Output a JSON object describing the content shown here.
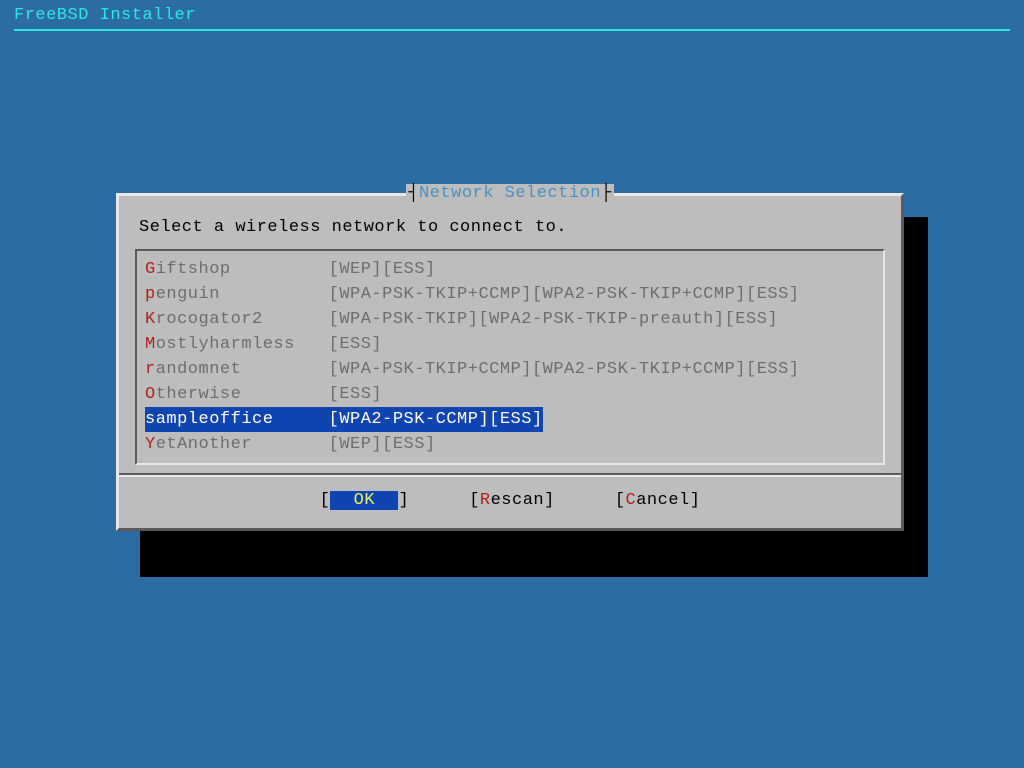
{
  "header": {
    "title": "FreeBSD Installer"
  },
  "dialog": {
    "title": "Network Selection",
    "prompt": "Select a wireless network to connect to.",
    "selected_index": 6,
    "networks": [
      {
        "hot": "G",
        "rest": "iftshop",
        "flags": "[WEP][ESS]"
      },
      {
        "hot": "p",
        "rest": "enguin",
        "flags": "[WPA-PSK-TKIP+CCMP][WPA2-PSK-TKIP+CCMP][ESS]"
      },
      {
        "hot": "K",
        "rest": "rocogator2",
        "flags": "[WPA-PSK-TKIP][WPA2-PSK-TKIP-preauth][ESS]"
      },
      {
        "hot": "M",
        "rest": "ostlyharmless",
        "flags": "[ESS]"
      },
      {
        "hot": "r",
        "rest": "andomnet",
        "flags": "[WPA-PSK-TKIP+CCMP][WPA2-PSK-TKIP+CCMP][ESS]"
      },
      {
        "hot": "O",
        "rest": "therwise",
        "flags": "[ESS]"
      },
      {
        "hot": "s",
        "rest": "ampleoffice",
        "flags": "[WPA2-PSK-CCMP][ESS]"
      },
      {
        "hot": "Y",
        "rest": "etAnother",
        "flags": "[WEP][ESS]"
      }
    ],
    "buttons": {
      "ok": {
        "label": "  OK  ",
        "focused": true
      },
      "rescan": {
        "pre": "",
        "hot": "R",
        "post": "escan"
      },
      "cancel": {
        "pre": "",
        "hot": "C",
        "post": "ancel"
      }
    }
  }
}
